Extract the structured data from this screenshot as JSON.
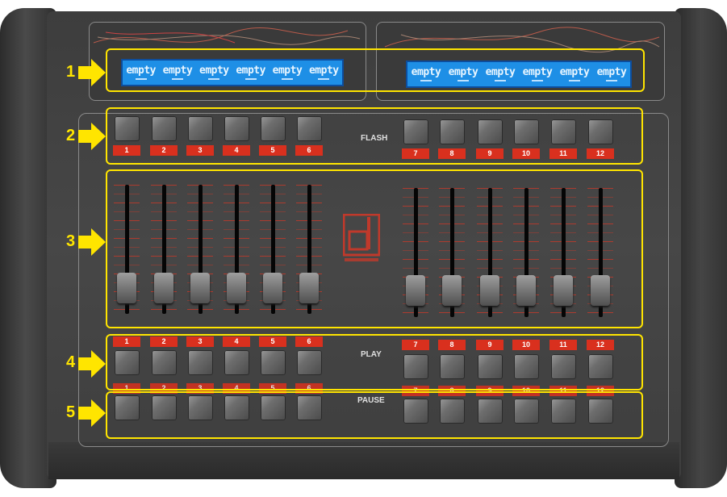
{
  "display_left": {
    "cells": [
      "empty",
      "empty",
      "empty",
      "empty",
      "empty",
      "empty"
    ]
  },
  "display_right": {
    "cells": [
      "empty",
      "empty",
      "empty",
      "empty",
      "empty",
      "empty"
    ]
  },
  "callouts": [
    "1",
    "2",
    "3",
    "4",
    "5"
  ],
  "section_labels": {
    "flash": "FLASH",
    "play": "PLAY",
    "pause": "PAUSE"
  },
  "flash_numbers": [
    "1",
    "2",
    "3",
    "4",
    "5",
    "6",
    "7",
    "8",
    "9",
    "10",
    "11",
    "12"
  ],
  "play_numbers": [
    "1",
    "2",
    "3",
    "4",
    "5",
    "6",
    "7",
    "8",
    "9",
    "10",
    "11",
    "12"
  ],
  "pause_numbers": [
    "1",
    "2",
    "3",
    "4",
    "5",
    "6",
    "7",
    "8",
    "9",
    "10",
    "11",
    "12"
  ],
  "colors": {
    "highlight": "#ffe500",
    "lcd": "#1e8fe6",
    "tag": "#d9301e",
    "chassis": "#454545"
  },
  "icons": {
    "callout_arrow": "arrow-right-icon",
    "brand": "red-lighting-logo-icon"
  }
}
